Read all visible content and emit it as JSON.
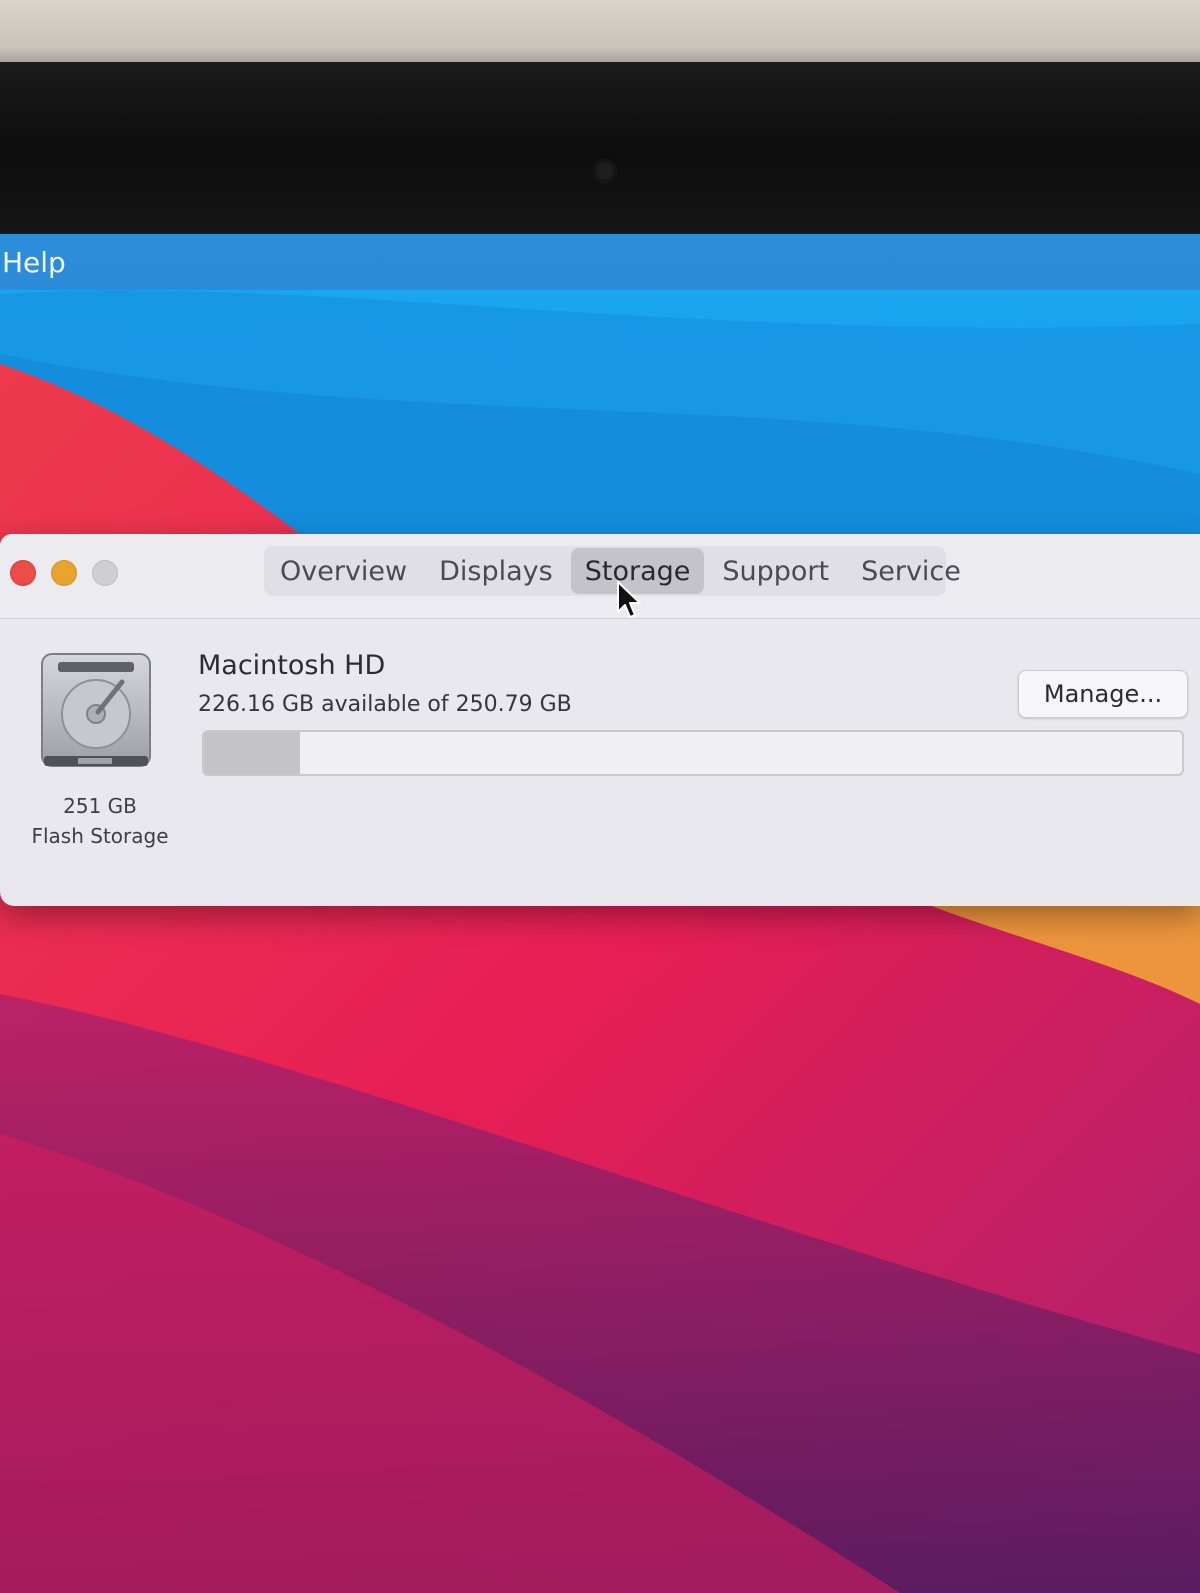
{
  "menubar": {
    "help_label": "Help"
  },
  "window": {
    "tabs": [
      {
        "label": "Overview"
      },
      {
        "label": "Displays"
      },
      {
        "label": "Storage"
      },
      {
        "label": "Support"
      },
      {
        "label": "Service"
      }
    ],
    "active_tab": "Storage",
    "disk": {
      "capacity": "251 GB",
      "type": "Flash Storage"
    },
    "volume": {
      "name": "Macintosh HD",
      "availability": "226.16 GB available of 250.79 GB",
      "used_fraction": 0.0982
    },
    "manage_label": "Manage..."
  },
  "colors": {
    "close": "#ec4d46",
    "minimize": "#e7a52e",
    "zoom": "#cfcfd3",
    "wallpaper_blue": "#1e9be8",
    "wallpaper_red": "#e8344a"
  }
}
